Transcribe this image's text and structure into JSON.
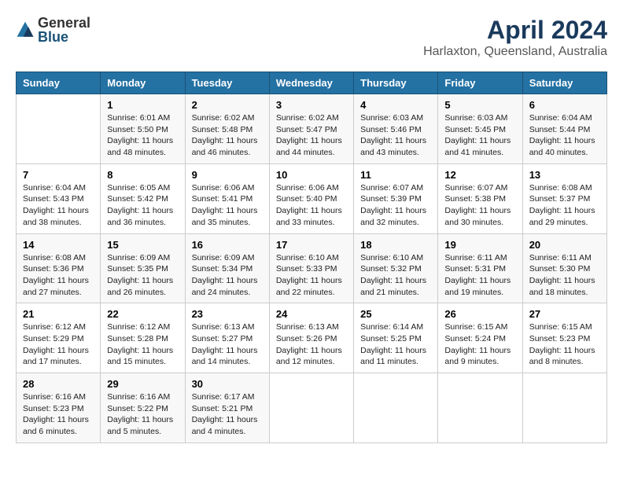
{
  "logo": {
    "general": "General",
    "blue": "Blue"
  },
  "title": "April 2024",
  "subtitle": "Harlaxton, Queensland, Australia",
  "headers": [
    "Sunday",
    "Monday",
    "Tuesday",
    "Wednesday",
    "Thursday",
    "Friday",
    "Saturday"
  ],
  "weeks": [
    [
      {
        "day": "",
        "info": ""
      },
      {
        "day": "1",
        "info": "Sunrise: 6:01 AM\nSunset: 5:50 PM\nDaylight: 11 hours\nand 48 minutes."
      },
      {
        "day": "2",
        "info": "Sunrise: 6:02 AM\nSunset: 5:48 PM\nDaylight: 11 hours\nand 46 minutes."
      },
      {
        "day": "3",
        "info": "Sunrise: 6:02 AM\nSunset: 5:47 PM\nDaylight: 11 hours\nand 44 minutes."
      },
      {
        "day": "4",
        "info": "Sunrise: 6:03 AM\nSunset: 5:46 PM\nDaylight: 11 hours\nand 43 minutes."
      },
      {
        "day": "5",
        "info": "Sunrise: 6:03 AM\nSunset: 5:45 PM\nDaylight: 11 hours\nand 41 minutes."
      },
      {
        "day": "6",
        "info": "Sunrise: 6:04 AM\nSunset: 5:44 PM\nDaylight: 11 hours\nand 40 minutes."
      }
    ],
    [
      {
        "day": "7",
        "info": "Sunrise: 6:04 AM\nSunset: 5:43 PM\nDaylight: 11 hours\nand 38 minutes."
      },
      {
        "day": "8",
        "info": "Sunrise: 6:05 AM\nSunset: 5:42 PM\nDaylight: 11 hours\nand 36 minutes."
      },
      {
        "day": "9",
        "info": "Sunrise: 6:06 AM\nSunset: 5:41 PM\nDaylight: 11 hours\nand 35 minutes."
      },
      {
        "day": "10",
        "info": "Sunrise: 6:06 AM\nSunset: 5:40 PM\nDaylight: 11 hours\nand 33 minutes."
      },
      {
        "day": "11",
        "info": "Sunrise: 6:07 AM\nSunset: 5:39 PM\nDaylight: 11 hours\nand 32 minutes."
      },
      {
        "day": "12",
        "info": "Sunrise: 6:07 AM\nSunset: 5:38 PM\nDaylight: 11 hours\nand 30 minutes."
      },
      {
        "day": "13",
        "info": "Sunrise: 6:08 AM\nSunset: 5:37 PM\nDaylight: 11 hours\nand 29 minutes."
      }
    ],
    [
      {
        "day": "14",
        "info": "Sunrise: 6:08 AM\nSunset: 5:36 PM\nDaylight: 11 hours\nand 27 minutes."
      },
      {
        "day": "15",
        "info": "Sunrise: 6:09 AM\nSunset: 5:35 PM\nDaylight: 11 hours\nand 26 minutes."
      },
      {
        "day": "16",
        "info": "Sunrise: 6:09 AM\nSunset: 5:34 PM\nDaylight: 11 hours\nand 24 minutes."
      },
      {
        "day": "17",
        "info": "Sunrise: 6:10 AM\nSunset: 5:33 PM\nDaylight: 11 hours\nand 22 minutes."
      },
      {
        "day": "18",
        "info": "Sunrise: 6:10 AM\nSunset: 5:32 PM\nDaylight: 11 hours\nand 21 minutes."
      },
      {
        "day": "19",
        "info": "Sunrise: 6:11 AM\nSunset: 5:31 PM\nDaylight: 11 hours\nand 19 minutes."
      },
      {
        "day": "20",
        "info": "Sunrise: 6:11 AM\nSunset: 5:30 PM\nDaylight: 11 hours\nand 18 minutes."
      }
    ],
    [
      {
        "day": "21",
        "info": "Sunrise: 6:12 AM\nSunset: 5:29 PM\nDaylight: 11 hours\nand 17 minutes."
      },
      {
        "day": "22",
        "info": "Sunrise: 6:12 AM\nSunset: 5:28 PM\nDaylight: 11 hours\nand 15 minutes."
      },
      {
        "day": "23",
        "info": "Sunrise: 6:13 AM\nSunset: 5:27 PM\nDaylight: 11 hours\nand 14 minutes."
      },
      {
        "day": "24",
        "info": "Sunrise: 6:13 AM\nSunset: 5:26 PM\nDaylight: 11 hours\nand 12 minutes."
      },
      {
        "day": "25",
        "info": "Sunrise: 6:14 AM\nSunset: 5:25 PM\nDaylight: 11 hours\nand 11 minutes."
      },
      {
        "day": "26",
        "info": "Sunrise: 6:15 AM\nSunset: 5:24 PM\nDaylight: 11 hours\nand 9 minutes."
      },
      {
        "day": "27",
        "info": "Sunrise: 6:15 AM\nSunset: 5:23 PM\nDaylight: 11 hours\nand 8 minutes."
      }
    ],
    [
      {
        "day": "28",
        "info": "Sunrise: 6:16 AM\nSunset: 5:23 PM\nDaylight: 11 hours\nand 6 minutes."
      },
      {
        "day": "29",
        "info": "Sunrise: 6:16 AM\nSunset: 5:22 PM\nDaylight: 11 hours\nand 5 minutes."
      },
      {
        "day": "30",
        "info": "Sunrise: 6:17 AM\nSunset: 5:21 PM\nDaylight: 11 hours\nand 4 minutes."
      },
      {
        "day": "",
        "info": ""
      },
      {
        "day": "",
        "info": ""
      },
      {
        "day": "",
        "info": ""
      },
      {
        "day": "",
        "info": ""
      }
    ]
  ]
}
